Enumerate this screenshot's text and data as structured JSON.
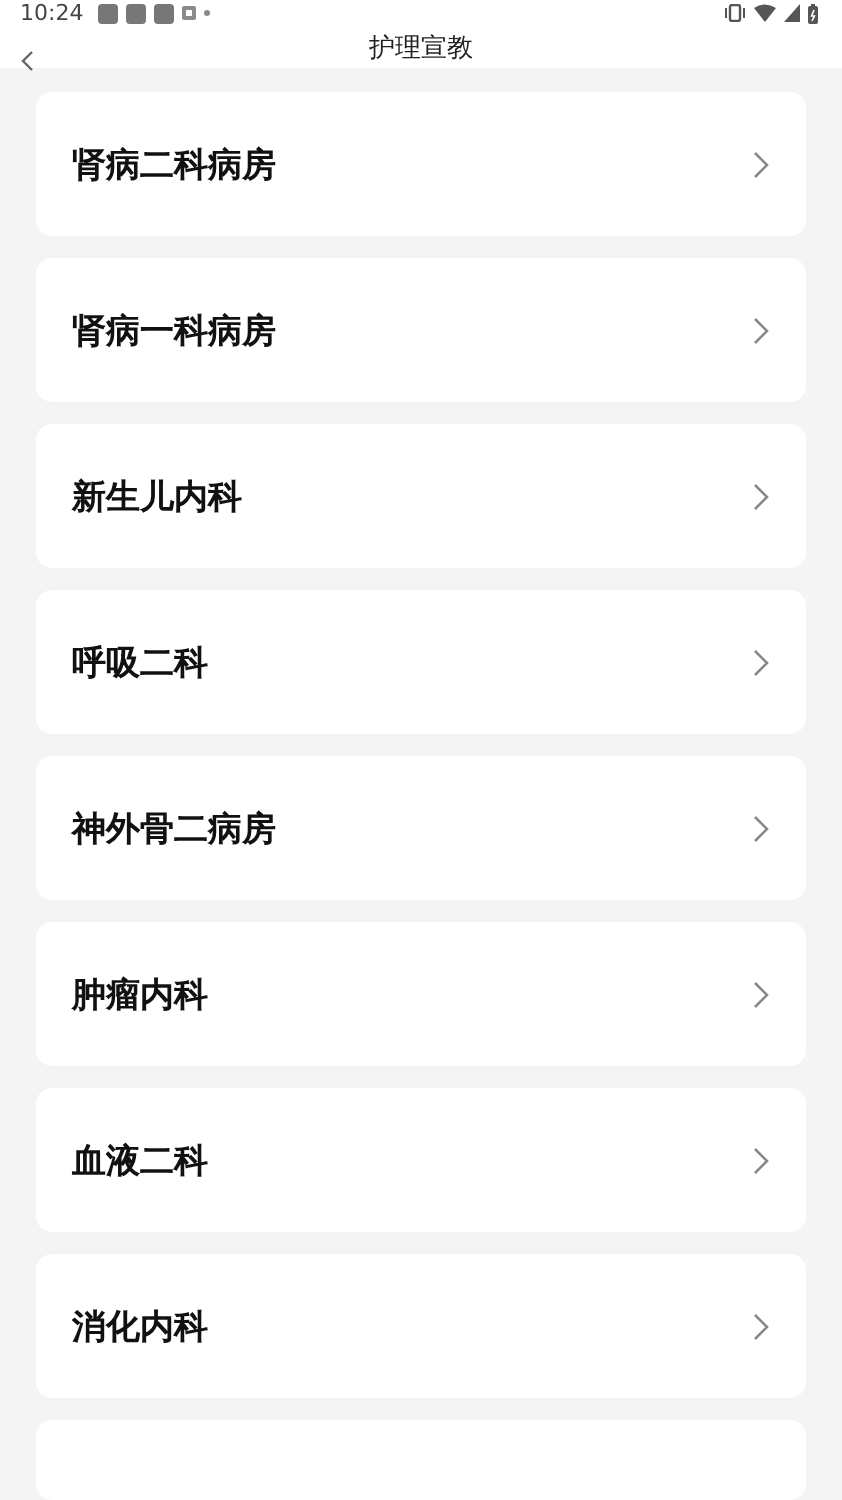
{
  "status_bar": {
    "time": "10:24"
  },
  "header": {
    "title": "护理宣教"
  },
  "departments": [
    {
      "name": "肾病二科病房"
    },
    {
      "name": "肾病一科病房"
    },
    {
      "name": "新生儿内科"
    },
    {
      "name": "呼吸二科"
    },
    {
      "name": "神外骨二病房"
    },
    {
      "name": "肿瘤内科"
    },
    {
      "name": "血液二科"
    },
    {
      "name": "消化内科"
    }
  ]
}
